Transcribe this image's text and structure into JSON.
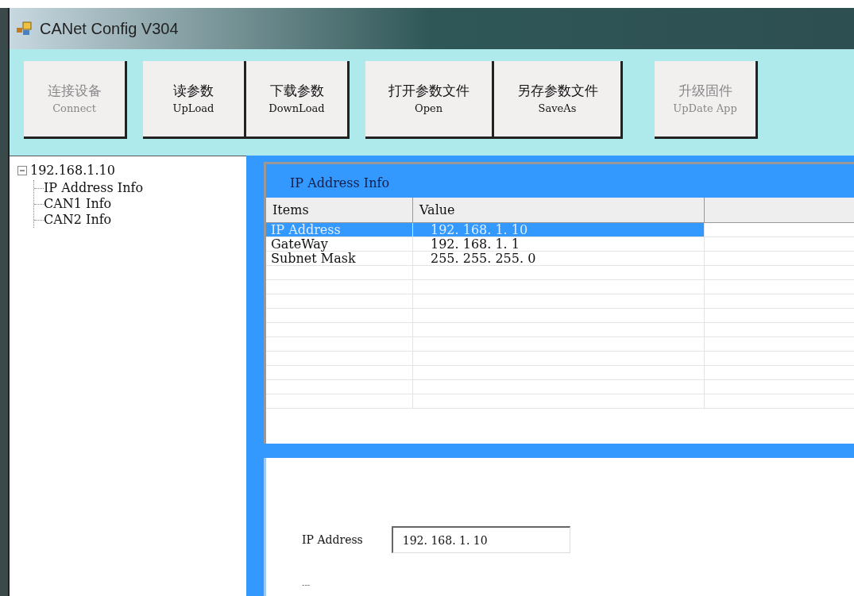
{
  "window": {
    "title": "CANet Config V304"
  },
  "toolbar": {
    "buttons": [
      {
        "label_cn": "连接设备",
        "label_en": "Connect",
        "disabled": true
      },
      {
        "label_cn": "读参数",
        "label_en": "UpLoad",
        "disabled": false
      },
      {
        "label_cn": "下载参数",
        "label_en": "DownLoad",
        "disabled": false
      },
      {
        "label_cn": "打开参数文件",
        "label_en": "Open",
        "disabled": false
      },
      {
        "label_cn": "另存参数文件",
        "label_en": "SaveAs",
        "disabled": false
      },
      {
        "label_cn": "升级固件",
        "label_en": "UpDate App",
        "disabled": true
      }
    ]
  },
  "tree": {
    "label": "192.168.1.10",
    "expanded": true,
    "children": [
      {
        "label": "IP Address Info"
      },
      {
        "label": "CAN1 Info"
      },
      {
        "label": "CAN2 Info"
      }
    ]
  },
  "info_panel": {
    "title": "IP Address Info",
    "columns": [
      "Items",
      "Value"
    ],
    "rows": [
      {
        "item": "IP Address",
        "value": "192. 168. 1. 10",
        "selected": true
      },
      {
        "item": "GateWay",
        "value": "192. 168. 1. 1",
        "selected": false
      },
      {
        "item": "Subnet Mask",
        "value": "255. 255. 255. 0",
        "selected": false
      }
    ]
  },
  "form": {
    "label": "IP Address",
    "value": "192. 168. 1. 10",
    "footer": "---"
  }
}
